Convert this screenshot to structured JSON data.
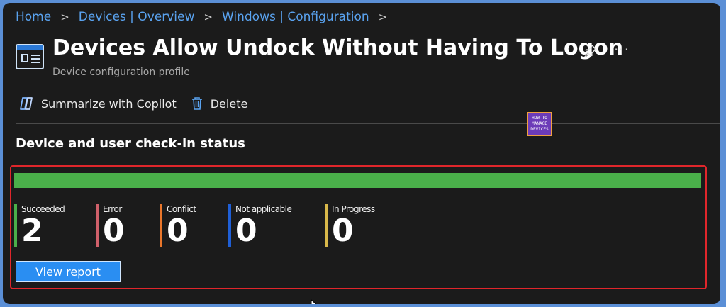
{
  "breadcrumb": {
    "items": [
      {
        "label": "Home"
      },
      {
        "label": "Devices | Overview"
      },
      {
        "label": "Windows | Configuration"
      }
    ],
    "separator": ">"
  },
  "header": {
    "title": "Devices Allow Undock Without Having To Logon",
    "subtitle": "Device configuration profile",
    "icons": {
      "profile": "device-profile-icon",
      "pin": "pin-icon",
      "more": "more-icon"
    },
    "more_label": "···"
  },
  "toolbar": {
    "copilot_label": "Summarize with Copilot",
    "delete_label": "Delete"
  },
  "watermark": {
    "lines": [
      "HOW TO",
      "MANAGE",
      "DEVICES"
    ]
  },
  "status": {
    "section_title": "Device and user check-in status",
    "succeeded_fraction": 1.0,
    "stats": [
      {
        "label": "Succeeded",
        "value": "2",
        "color": "#4ab04a"
      },
      {
        "label": "Error",
        "value": "0",
        "color": "#d0606a"
      },
      {
        "label": "Conflict",
        "value": "0",
        "color": "#e9762b"
      },
      {
        "label": "Not applicable",
        "value": "0",
        "color": "#1f5fd6"
      },
      {
        "label": "In Progress",
        "value": "0",
        "color": "#d8b84a"
      }
    ],
    "view_report_label": "View report"
  },
  "colors": {
    "accent": "#2a8ef2",
    "highlight_border": "#e0262b",
    "success": "#4ab04a"
  }
}
